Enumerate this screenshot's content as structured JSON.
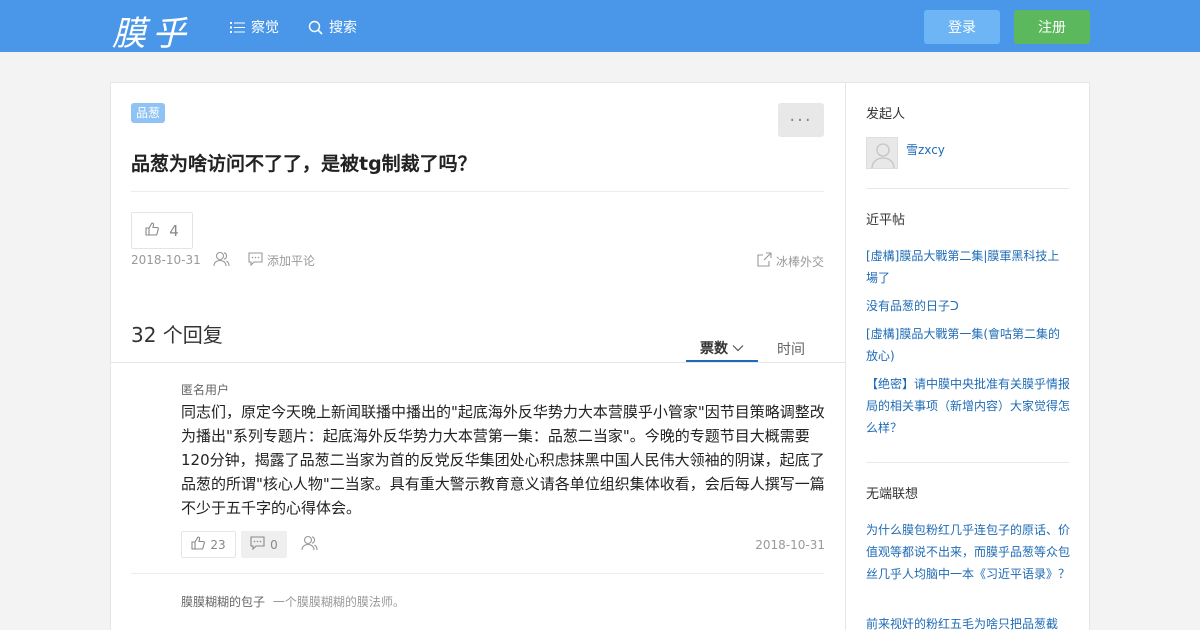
{
  "header": {
    "logo": "膜乎",
    "nav": [
      {
        "label": "察觉",
        "icon": "list-icon"
      },
      {
        "label": "搜索",
        "icon": "search-icon"
      }
    ],
    "login_label": "登录",
    "register_label": "注册",
    "colors": {
      "bar": "#4a97e9",
      "login": "#6db5f5",
      "register": "#5cb85c"
    }
  },
  "question": {
    "tag": "品葱",
    "more_label": "···",
    "title": "品葱为啥访问不了了，是被tg制裁了吗？",
    "votes": "4",
    "date": "2018-10-31",
    "add_comment": "添加平论",
    "share": "冰棒外交"
  },
  "answers_section": {
    "count_label": "32 个回复",
    "sort_tabs": [
      {
        "label": "票数",
        "active": true
      },
      {
        "label": "时间",
        "active": false
      }
    ]
  },
  "answers": [
    {
      "author": "匿名用户",
      "body": "同志们，原定今天晚上新闻联播中播出的\"起底海外反华势力大本营膜乎小管家\"因节目策略调整改为播出\"系列专题片：起底海外反华势力大本营第一集：品葱二当家\"。今晚的专题节目大概需要120分钟，揭露了品葱二当家为首的反党反华集团处心积虑抹黑中国人民伟大领袖的阴谋，起底了品葱的所谓\"核心人物\"二当家。具有重大警示教育意义请各单位组织集体收看，会后每人撰写一篇不少于五千字的心得体会。",
      "votes": "23",
      "comments": "0",
      "date": "2018-10-31"
    },
    {
      "author": "膜膜糊糊的包子",
      "signature": "一个膜膜糊糊的膜法师。"
    }
  ],
  "sidebar": {
    "starter_heading": "发起人",
    "starter_name": "雪zxcy",
    "recent_heading": "近平帖",
    "recent_links": [
      "[虛構]膜品大戰第二集|膜軍黑科技上場了",
      "没有品葱的日子ᑐ",
      "[虛構]膜品大戰第一集(會咕第二集的放心)",
      "【绝密】请中膜中央批准有关膜乎情报局的相关事项（新增内容）大家觉得怎么样？"
    ],
    "related_heading": "无端联想",
    "related_links": [
      "为什么膜包粉红几乎连包子的原话、价值观等都说不出来，而膜乎品葱等众包丝几乎人均脑中一本《习近平语录》？",
      "前来视奸的粉红五毛为啥只把品葱截"
    ]
  }
}
